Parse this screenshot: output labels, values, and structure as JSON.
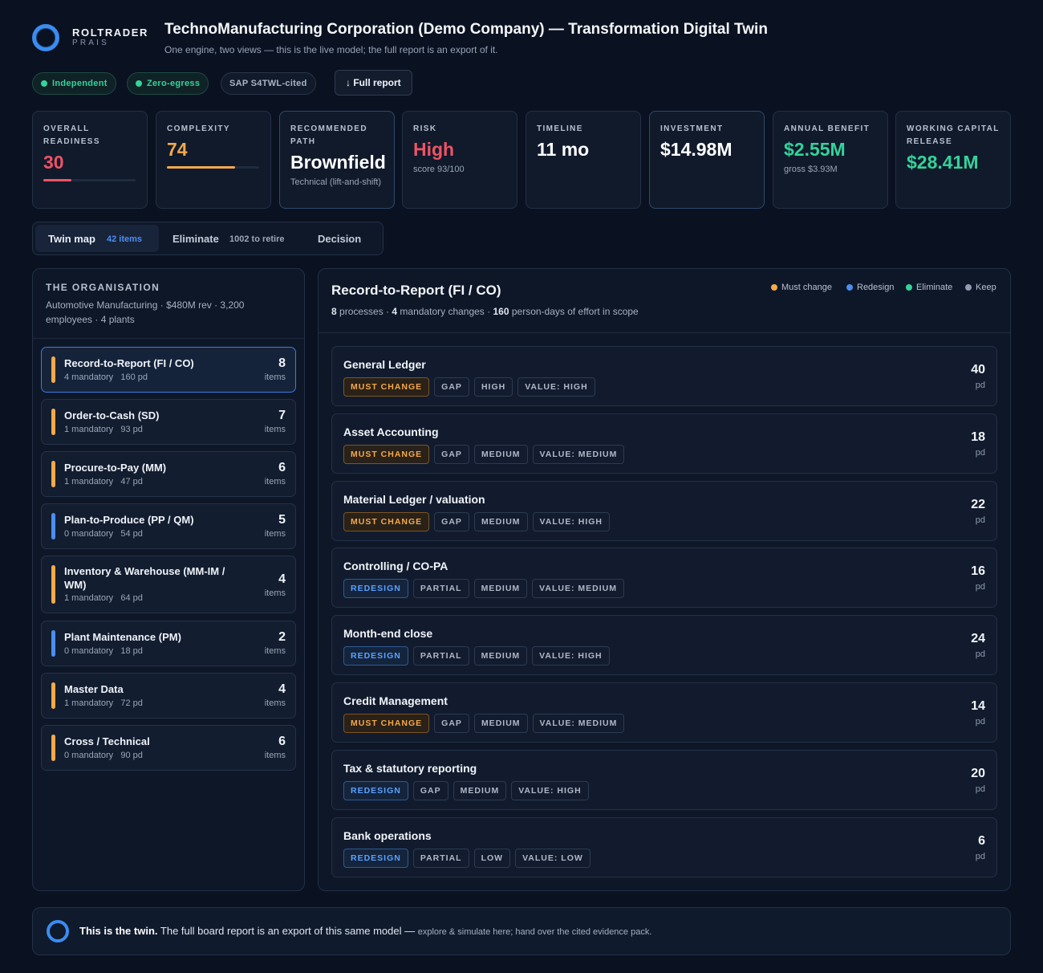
{
  "brand": {
    "name": "ROLTRADER",
    "sub": "PRAIS"
  },
  "header": {
    "title": "TechnoManufacturing Corporation (Demo Company) — Transformation Digital Twin",
    "subtitle": "One engine, two views — this is the live model; the full report is an export of it."
  },
  "badges": {
    "independent": "Independent",
    "zero_egress": "Zero-egress",
    "cited": "SAP S4TWL-cited"
  },
  "full_report_button": "↓ Full report",
  "metrics": {
    "readiness": {
      "label": "Overall readiness",
      "value": "30",
      "progress": 0.3,
      "color": "#f05265"
    },
    "complexity": {
      "label": "Complexity",
      "value": "74",
      "progress": 0.74,
      "color": "#f3a94a"
    },
    "path": {
      "label": "Recommended path",
      "value": "Brownfield",
      "sub": "Technical (lift-and-shift)"
    },
    "risk": {
      "label": "Risk",
      "value": "High",
      "sub": "score 93/100"
    },
    "timeline": {
      "label": "Timeline",
      "value": "11 mo"
    },
    "investment": {
      "label": "Investment",
      "value": "$14.98M"
    },
    "benefit": {
      "label": "Annual benefit",
      "value": "$2.55M",
      "sub": "gross $3.93M"
    },
    "working_capital": {
      "label": "Working capital release",
      "value": "$28.41M"
    }
  },
  "tabs": {
    "twin": {
      "label": "Twin map",
      "count": "42 items"
    },
    "eliminate": {
      "label": "Eliminate",
      "count": "1002 to retire"
    },
    "decision": {
      "label": "Decision"
    }
  },
  "organisation": {
    "heading": "THE ORGANISATION",
    "description": "Automotive Manufacturing · $480M rev · 3,200 employees · 4 plants"
  },
  "processes": [
    {
      "name": "Record-to-Report (FI / CO)",
      "mandatory": "4 mandatory",
      "pd": "160 pd",
      "count": "8",
      "items": "items",
      "accent": "#f3a94a"
    },
    {
      "name": "Order-to-Cash (SD)",
      "mandatory": "1 mandatory",
      "pd": "93 pd",
      "count": "7",
      "items": "items",
      "accent": "#f3a94a"
    },
    {
      "name": "Procure-to-Pay (MM)",
      "mandatory": "1 mandatory",
      "pd": "47 pd",
      "count": "6",
      "items": "items",
      "accent": "#f3a94a"
    },
    {
      "name": "Plan-to-Produce (PP / QM)",
      "mandatory": "0 mandatory",
      "pd": "54 pd",
      "count": "5",
      "items": "items",
      "accent": "#4b8ef0"
    },
    {
      "name": "Inventory & Warehouse (MM-IM / WM)",
      "mandatory": "1 mandatory",
      "pd": "64 pd",
      "count": "4",
      "items": "items",
      "accent": "#f3a94a"
    },
    {
      "name": "Plant Maintenance (PM)",
      "mandatory": "0 mandatory",
      "pd": "18 pd",
      "count": "2",
      "items": "items",
      "accent": "#4b8ef0"
    },
    {
      "name": "Master Data",
      "mandatory": "1 mandatory",
      "pd": "72 pd",
      "count": "4",
      "items": "items",
      "accent": "#f3a94a"
    },
    {
      "name": "Cross / Technical",
      "mandatory": "0 mandatory",
      "pd": "90 pd",
      "count": "6",
      "items": "items",
      "accent": "#f3a94a"
    }
  ],
  "detail": {
    "title": "Record-to-Report (FI / CO)",
    "summary": {
      "processes": "8",
      "processes_label": " processes · ",
      "mandatory": "4",
      "mandatory_label": " mandatory changes · ",
      "effort": "160",
      "effort_label": " person-days of effort in scope"
    },
    "legend": {
      "must": "Must change",
      "redesign": "Redesign",
      "eliminate": "Eliminate",
      "keep": "Keep"
    },
    "rows": [
      {
        "name": "General Ledger",
        "action": "MUST CHANGE",
        "fit": "GAP",
        "complexity": "HIGH",
        "value": "VALUE: HIGH",
        "pd": "40",
        "unit": "pd"
      },
      {
        "name": "Asset Accounting",
        "action": "MUST CHANGE",
        "fit": "GAP",
        "complexity": "MEDIUM",
        "value": "VALUE: MEDIUM",
        "pd": "18",
        "unit": "pd"
      },
      {
        "name": "Material Ledger / valuation",
        "action": "MUST CHANGE",
        "fit": "GAP",
        "complexity": "MEDIUM",
        "value": "VALUE: HIGH",
        "pd": "22",
        "unit": "pd"
      },
      {
        "name": "Controlling / CO-PA",
        "action": "REDESIGN",
        "fit": "PARTIAL",
        "complexity": "MEDIUM",
        "value": "VALUE: MEDIUM",
        "pd": "16",
        "unit": "pd"
      },
      {
        "name": "Month-end close",
        "action": "REDESIGN",
        "fit": "PARTIAL",
        "complexity": "MEDIUM",
        "value": "VALUE: HIGH",
        "pd": "24",
        "unit": "pd"
      },
      {
        "name": "Credit Management",
        "action": "MUST CHANGE",
        "fit": "GAP",
        "complexity": "MEDIUM",
        "value": "VALUE: MEDIUM",
        "pd": "14",
        "unit": "pd"
      },
      {
        "name": "Tax & statutory reporting",
        "action": "REDESIGN",
        "fit": "GAP",
        "complexity": "MEDIUM",
        "value": "VALUE: HIGH",
        "pd": "20",
        "unit": "pd"
      },
      {
        "name": "Bank operations",
        "action": "REDESIGN",
        "fit": "PARTIAL",
        "complexity": "LOW",
        "value": "VALUE: LOW",
        "pd": "6",
        "unit": "pd"
      }
    ]
  },
  "footer": {
    "lead": "This is the twin.",
    "text": " The full board report is an export of this same model — ",
    "small": "explore & simulate here; hand over the cited evidence pack."
  }
}
